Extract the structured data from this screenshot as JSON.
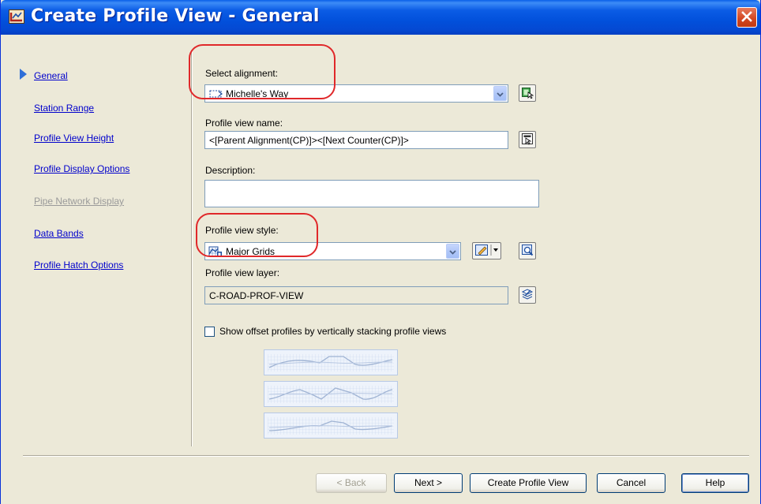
{
  "window": {
    "title": "Create Profile View - General"
  },
  "nav": {
    "items": [
      {
        "label": "General",
        "state": "active"
      },
      {
        "label": "Station Range",
        "state": "normal"
      },
      {
        "label": "Profile View Height",
        "state": "normal"
      },
      {
        "label": "Profile Display Options",
        "state": "normal"
      },
      {
        "label": "Pipe Network Display",
        "state": "disabled"
      },
      {
        "label": "Data Bands",
        "state": "normal"
      },
      {
        "label": "Profile Hatch Options",
        "state": "normal"
      }
    ]
  },
  "form": {
    "select_alignment_label": "Select alignment:",
    "alignment_value": "Michelle's Way",
    "profile_view_name_label": "Profile view name:",
    "profile_view_name_value": "<[Parent Alignment(CP)]><[Next Counter(CP)]>",
    "description_label": "Description:",
    "description_value": "",
    "profile_view_style_label": "Profile view style:",
    "profile_view_style_value": "Major Grids",
    "profile_view_layer_label": "Profile view layer:",
    "profile_view_layer_value": "C-ROAD-PROF-VIEW",
    "stack_checkbox_label": "Show offset profiles by vertically stacking profile views",
    "stack_checkbox_checked": false
  },
  "buttons": {
    "back": "< Back",
    "next": "Next >",
    "create": "Create Profile View",
    "cancel": "Cancel",
    "help": "Help"
  },
  "colors": {
    "titlebar": "#0250db",
    "link": "#0000cc",
    "disabled_text": "#9a9a9a",
    "highlight": "#e0282a",
    "dialog_bg": "#ece9d8"
  },
  "icons": {
    "app": "civil3d-app-icon",
    "close": "close-icon",
    "alignment": "alignment-icon",
    "pick_alignment": "pick-from-drawing-icon",
    "edit_name": "edit-name-format-icon",
    "style": "profile-view-style-icon",
    "edit_style": "edit-style-icon",
    "preview_style": "style-preview-icon",
    "layer": "layer-icon"
  }
}
